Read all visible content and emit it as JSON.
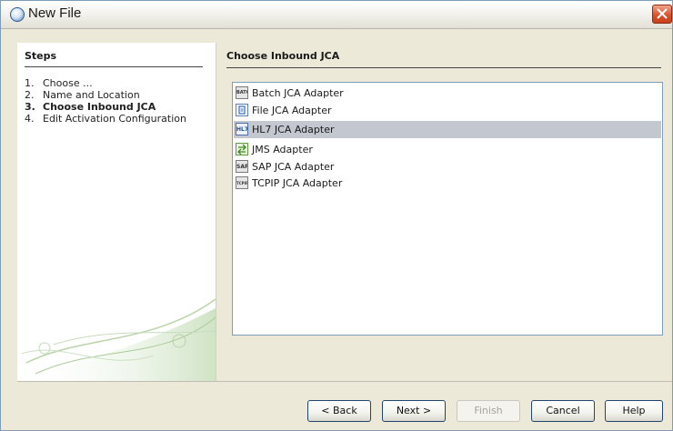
{
  "window": {
    "title": "New File"
  },
  "steps": {
    "heading": "Steps",
    "items": [
      {
        "num": "1.",
        "label": "Choose ..."
      },
      {
        "num": "2.",
        "label": "Name and Location"
      },
      {
        "num": "3.",
        "label": "Choose Inbound JCA",
        "active": true
      },
      {
        "num": "4.",
        "label": "Edit Activation Configuration"
      }
    ]
  },
  "content": {
    "heading": "Choose Inbound JCA",
    "adapters": [
      {
        "label": "Batch JCA Adapter",
        "icon": "batch-adapter-icon",
        "icon_text": "BATCH"
      },
      {
        "label": "File JCA Adapter",
        "icon": "file-adapter-icon",
        "icon_text": ""
      },
      {
        "label": "HL7 JCA Adapter",
        "icon": "hl7-adapter-icon",
        "icon_text": "HL7",
        "selected": true
      },
      {
        "label": "JMS Adapter",
        "icon": "jms-adapter-icon",
        "icon_text": ""
      },
      {
        "label": "SAP JCA Adapter",
        "icon": "sap-adapter-icon",
        "icon_text": "SAP"
      },
      {
        "label": "TCPIP JCA Adapter",
        "icon": "tcpip-adapter-icon",
        "icon_text": "TCPIP"
      }
    ]
  },
  "buttons": {
    "back": "< Back",
    "next": "Next >",
    "finish": "Finish",
    "cancel": "Cancel",
    "help": "Help"
  },
  "colors": {
    "selection": "#c2c7d0",
    "close": "#d9532b",
    "border": "#7f9db9"
  }
}
